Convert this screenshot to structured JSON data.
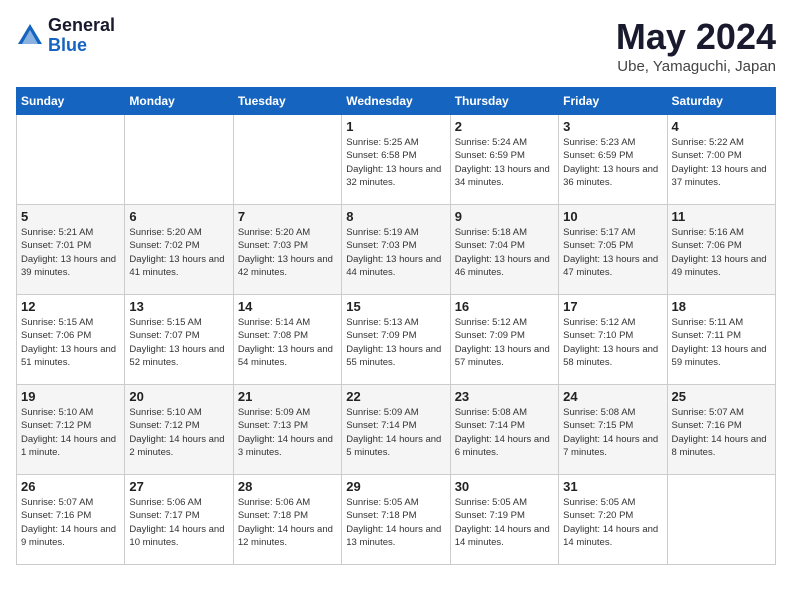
{
  "logo": {
    "general": "General",
    "blue": "Blue"
  },
  "title": "May 2024",
  "location": "Ube, Yamaguchi, Japan",
  "days_of_week": [
    "Sunday",
    "Monday",
    "Tuesday",
    "Wednesday",
    "Thursday",
    "Friday",
    "Saturday"
  ],
  "weeks": [
    [
      null,
      null,
      null,
      {
        "day": "1",
        "sunrise": "Sunrise: 5:25 AM",
        "sunset": "Sunset: 6:58 PM",
        "daylight": "Daylight: 13 hours and 32 minutes."
      },
      {
        "day": "2",
        "sunrise": "Sunrise: 5:24 AM",
        "sunset": "Sunset: 6:59 PM",
        "daylight": "Daylight: 13 hours and 34 minutes."
      },
      {
        "day": "3",
        "sunrise": "Sunrise: 5:23 AM",
        "sunset": "Sunset: 6:59 PM",
        "daylight": "Daylight: 13 hours and 36 minutes."
      },
      {
        "day": "4",
        "sunrise": "Sunrise: 5:22 AM",
        "sunset": "Sunset: 7:00 PM",
        "daylight": "Daylight: 13 hours and 37 minutes."
      }
    ],
    [
      {
        "day": "5",
        "sunrise": "Sunrise: 5:21 AM",
        "sunset": "Sunset: 7:01 PM",
        "daylight": "Daylight: 13 hours and 39 minutes."
      },
      {
        "day": "6",
        "sunrise": "Sunrise: 5:20 AM",
        "sunset": "Sunset: 7:02 PM",
        "daylight": "Daylight: 13 hours and 41 minutes."
      },
      {
        "day": "7",
        "sunrise": "Sunrise: 5:20 AM",
        "sunset": "Sunset: 7:03 PM",
        "daylight": "Daylight: 13 hours and 42 minutes."
      },
      {
        "day": "8",
        "sunrise": "Sunrise: 5:19 AM",
        "sunset": "Sunset: 7:03 PM",
        "daylight": "Daylight: 13 hours and 44 minutes."
      },
      {
        "day": "9",
        "sunrise": "Sunrise: 5:18 AM",
        "sunset": "Sunset: 7:04 PM",
        "daylight": "Daylight: 13 hours and 46 minutes."
      },
      {
        "day": "10",
        "sunrise": "Sunrise: 5:17 AM",
        "sunset": "Sunset: 7:05 PM",
        "daylight": "Daylight: 13 hours and 47 minutes."
      },
      {
        "day": "11",
        "sunrise": "Sunrise: 5:16 AM",
        "sunset": "Sunset: 7:06 PM",
        "daylight": "Daylight: 13 hours and 49 minutes."
      }
    ],
    [
      {
        "day": "12",
        "sunrise": "Sunrise: 5:15 AM",
        "sunset": "Sunset: 7:06 PM",
        "daylight": "Daylight: 13 hours and 51 minutes."
      },
      {
        "day": "13",
        "sunrise": "Sunrise: 5:15 AM",
        "sunset": "Sunset: 7:07 PM",
        "daylight": "Daylight: 13 hours and 52 minutes."
      },
      {
        "day": "14",
        "sunrise": "Sunrise: 5:14 AM",
        "sunset": "Sunset: 7:08 PM",
        "daylight": "Daylight: 13 hours and 54 minutes."
      },
      {
        "day": "15",
        "sunrise": "Sunrise: 5:13 AM",
        "sunset": "Sunset: 7:09 PM",
        "daylight": "Daylight: 13 hours and 55 minutes."
      },
      {
        "day": "16",
        "sunrise": "Sunrise: 5:12 AM",
        "sunset": "Sunset: 7:09 PM",
        "daylight": "Daylight: 13 hours and 57 minutes."
      },
      {
        "day": "17",
        "sunrise": "Sunrise: 5:12 AM",
        "sunset": "Sunset: 7:10 PM",
        "daylight": "Daylight: 13 hours and 58 minutes."
      },
      {
        "day": "18",
        "sunrise": "Sunrise: 5:11 AM",
        "sunset": "Sunset: 7:11 PM",
        "daylight": "Daylight: 13 hours and 59 minutes."
      }
    ],
    [
      {
        "day": "19",
        "sunrise": "Sunrise: 5:10 AM",
        "sunset": "Sunset: 7:12 PM",
        "daylight": "Daylight: 14 hours and 1 minute."
      },
      {
        "day": "20",
        "sunrise": "Sunrise: 5:10 AM",
        "sunset": "Sunset: 7:12 PM",
        "daylight": "Daylight: 14 hours and 2 minutes."
      },
      {
        "day": "21",
        "sunrise": "Sunrise: 5:09 AM",
        "sunset": "Sunset: 7:13 PM",
        "daylight": "Daylight: 14 hours and 3 minutes."
      },
      {
        "day": "22",
        "sunrise": "Sunrise: 5:09 AM",
        "sunset": "Sunset: 7:14 PM",
        "daylight": "Daylight: 14 hours and 5 minutes."
      },
      {
        "day": "23",
        "sunrise": "Sunrise: 5:08 AM",
        "sunset": "Sunset: 7:14 PM",
        "daylight": "Daylight: 14 hours and 6 minutes."
      },
      {
        "day": "24",
        "sunrise": "Sunrise: 5:08 AM",
        "sunset": "Sunset: 7:15 PM",
        "daylight": "Daylight: 14 hours and 7 minutes."
      },
      {
        "day": "25",
        "sunrise": "Sunrise: 5:07 AM",
        "sunset": "Sunset: 7:16 PM",
        "daylight": "Daylight: 14 hours and 8 minutes."
      }
    ],
    [
      {
        "day": "26",
        "sunrise": "Sunrise: 5:07 AM",
        "sunset": "Sunset: 7:16 PM",
        "daylight": "Daylight: 14 hours and 9 minutes."
      },
      {
        "day": "27",
        "sunrise": "Sunrise: 5:06 AM",
        "sunset": "Sunset: 7:17 PM",
        "daylight": "Daylight: 14 hours and 10 minutes."
      },
      {
        "day": "28",
        "sunrise": "Sunrise: 5:06 AM",
        "sunset": "Sunset: 7:18 PM",
        "daylight": "Daylight: 14 hours and 12 minutes."
      },
      {
        "day": "29",
        "sunrise": "Sunrise: 5:05 AM",
        "sunset": "Sunset: 7:18 PM",
        "daylight": "Daylight: 14 hours and 13 minutes."
      },
      {
        "day": "30",
        "sunrise": "Sunrise: 5:05 AM",
        "sunset": "Sunset: 7:19 PM",
        "daylight": "Daylight: 14 hours and 14 minutes."
      },
      {
        "day": "31",
        "sunrise": "Sunrise: 5:05 AM",
        "sunset": "Sunset: 7:20 PM",
        "daylight": "Daylight: 14 hours and 14 minutes."
      },
      null
    ]
  ]
}
